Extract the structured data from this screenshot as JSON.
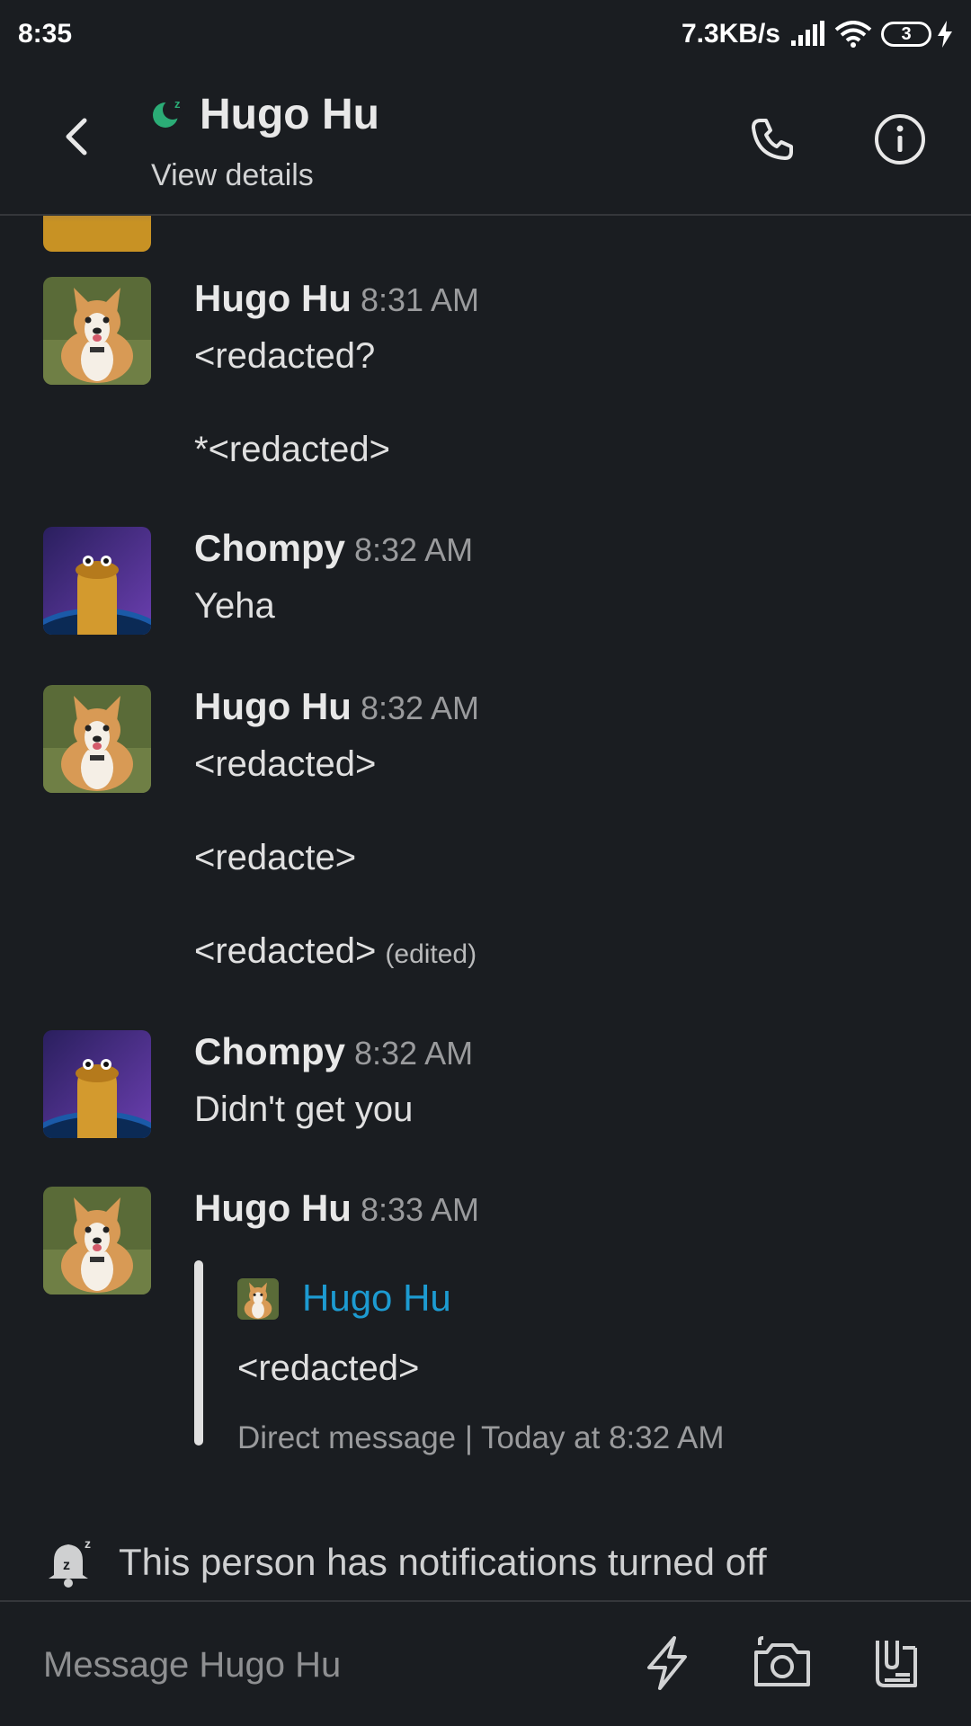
{
  "status_bar": {
    "time": "8:35",
    "network_speed": "7.3KB/s",
    "battery_level": "3",
    "icons": [
      "signal-icon",
      "wifi-icon",
      "battery-icon",
      "charging-icon"
    ]
  },
  "header": {
    "title": "Hugo Hu",
    "subtitle": "View details",
    "icons": [
      "back-arrow-icon",
      "away-status-icon",
      "phone-icon",
      "info-icon"
    ]
  },
  "messages": [
    {
      "sender": "Hugo Hu",
      "time": "8:31 AM",
      "avatar": "corgi",
      "lines": [
        "<redacted?",
        "*<redacted>"
      ]
    },
    {
      "sender": "Chompy",
      "time": "8:32 AM",
      "avatar": "chompy",
      "lines": [
        "Yeha"
      ]
    },
    {
      "sender": "Hugo Hu",
      "time": "8:32 AM",
      "avatar": "corgi",
      "lines": [
        "<redacted>",
        "<redacte>",
        "<redacted>"
      ],
      "edited_label": "(edited)"
    },
    {
      "sender": "Chompy",
      "time": "8:32 AM",
      "avatar": "chompy",
      "lines": [
        "Didn't get you"
      ]
    },
    {
      "sender": "Hugo Hu",
      "time": "8:33 AM",
      "avatar": "corgi",
      "quote": {
        "author": "Hugo Hu",
        "text": "<redacted>",
        "meta": "Direct message | Today at 8:32 AM"
      }
    }
  ],
  "notification_banner": {
    "text": "This person has notifications turned off",
    "icon": "bell-snooze-icon"
  },
  "composer": {
    "placeholder": "Message Hugo Hu",
    "icons": [
      "shortcuts-lightning-icon",
      "camera-icon",
      "attach-files-icon"
    ]
  },
  "colors": {
    "background": "#1a1d21",
    "link_blue": "#1d9bd1",
    "presence_green": "#2bac76",
    "muted_text": "#9a9b9d"
  }
}
